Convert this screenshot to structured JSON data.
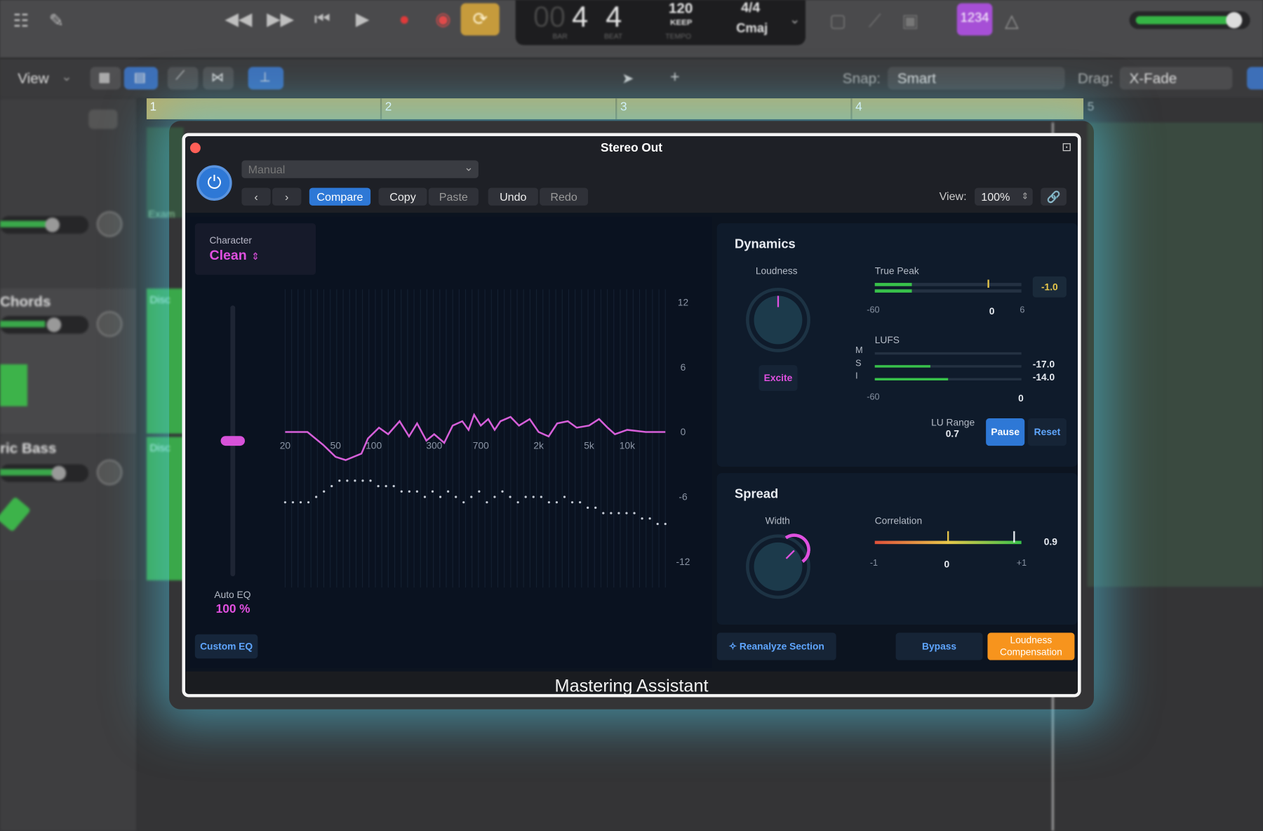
{
  "topbar": {
    "lcd_bar": "4",
    "lcd_bar_faded": "00",
    "lcd_beat": "4",
    "lcd_bar_label": "BAR",
    "lcd_beat_label": "BEAT",
    "tempo": "120",
    "tempo_mode": "KEEP",
    "tempo_label": "TEMPO",
    "signature": "4/4",
    "key": "Cmaj",
    "count_in": "1234"
  },
  "toolbar2": {
    "view_label": "View",
    "snap_label": "Snap:",
    "snap_value": "Smart",
    "drag_label": "Drag:",
    "drag_value": "X-Fade"
  },
  "ruler": {
    "marks": [
      "1",
      "2",
      "3",
      "4",
      "5"
    ]
  },
  "tracks": [
    {
      "name": "Chords"
    },
    {
      "name": "ric Bass"
    }
  ],
  "regions": [
    "Exam",
    "Disc",
    "Disc"
  ],
  "plugin": {
    "title": "Stereo Out",
    "preset": "Manual",
    "compare_label": "Compare",
    "copy_label": "Copy",
    "paste_label": "Paste",
    "undo_label": "Undo",
    "redo_label": "Redo",
    "view_label": "View:",
    "view_value": "100%",
    "footer": "Mastering Assistant"
  },
  "eq": {
    "character_label": "Character",
    "character_value": "Clean",
    "auto_eq_label": "Auto EQ",
    "auto_eq_value": "100 %",
    "auto_eq_level": 0.5,
    "custom_eq_label": "Custom EQ",
    "freq_labels": [
      "20",
      "50",
      "100",
      "300",
      "700",
      "2k",
      "5k",
      "10k"
    ],
    "db_labels": [
      "12",
      "6",
      "0",
      "-6",
      "-12"
    ],
    "curve_color": "#d65fd9"
  },
  "dynamics": {
    "title": "Dynamics",
    "loudness_label": "Loudness",
    "excite_label": "Excite",
    "true_peak_label": "True Peak",
    "true_peak_value": "-1.0",
    "true_peak_scale": [
      "-60",
      "0",
      "6"
    ],
    "lufs_label": "LUFS",
    "lufs_rows": [
      {
        "tag": "M",
        "value": "",
        "level": 0.0
      },
      {
        "tag": "S",
        "value": "-17.0",
        "level": 0.38
      },
      {
        "tag": "I",
        "value": "-14.0",
        "level": 0.5
      }
    ],
    "lufs_scale": [
      "-60",
      "0"
    ],
    "lu_range_label": "LU Range",
    "lu_range_value": "0.7",
    "pause_label": "Pause",
    "reset_label": "Reset"
  },
  "spread": {
    "title": "Spread",
    "width_label": "Width",
    "correlation_label": "Correlation",
    "correlation_value": "0.9",
    "correlation_scale": [
      "-1",
      "0",
      "+1"
    ]
  },
  "bottom": {
    "reanalyze_label": "Reanalyze Section",
    "bypass_label": "Bypass",
    "loudness_comp_label": "Loudness Compensation"
  },
  "colors": {
    "accent_blue": "#2e78d6",
    "accent_pink": "#e050e0",
    "accent_orange": "#f7941d",
    "meter_green": "#38c24a"
  }
}
